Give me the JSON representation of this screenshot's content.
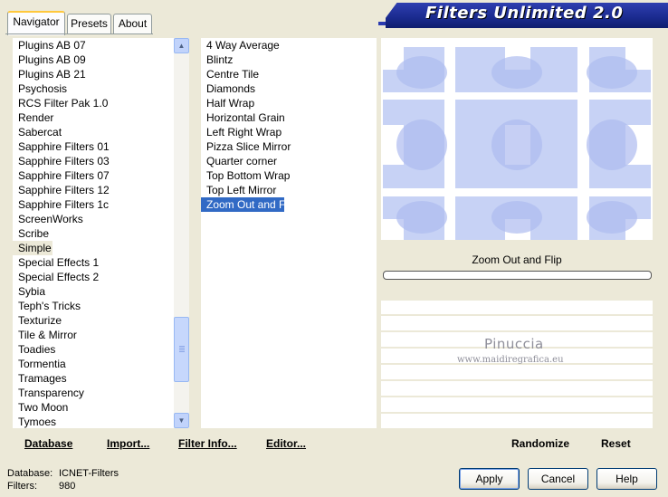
{
  "tabs": [
    {
      "label": "Navigator",
      "active": true
    },
    {
      "label": "Presets",
      "active": false
    },
    {
      "label": "About",
      "active": false
    }
  ],
  "title": "Filters Unlimited 2.0",
  "categories": [
    "Plugins AB 07",
    "Plugins AB 09",
    "Plugins AB 21",
    "Psychosis",
    "RCS Filter Pak 1.0",
    "Render",
    "Sabercat",
    "Sapphire Filters 01",
    "Sapphire Filters 03",
    "Sapphire Filters 07",
    "Sapphire Filters 12",
    "Sapphire Filters 1c",
    "ScreenWorks",
    "Scribe",
    "Simple",
    "Special Effects 1",
    "Special Effects 2",
    "Sybia",
    "Teph's Tricks",
    "Texturize",
    "Tile & Mirror",
    "Toadies",
    "Tormentia",
    "Tramages",
    "Transparency",
    "Two Moon",
    "Tymoes"
  ],
  "selected_category": "Simple",
  "filters": [
    "4 Way Average",
    "Blintz",
    "Centre Tile",
    "Diamonds",
    "Half Wrap",
    "Horizontal Grain",
    "Left Right Wrap",
    "Pizza Slice Mirror",
    "Quarter corner",
    "Top Bottom Wrap",
    "Top Left Mirror",
    "Zoom Out and Flip"
  ],
  "selected_filter": "Zoom Out and Flip",
  "preview_name": "Zoom Out and Flip",
  "progress": 0,
  "watermark": {
    "line1": "Pinuccia",
    "line2": "www.maidiregrafica.eu"
  },
  "bottom_links": {
    "database": "Database",
    "import": "Import...",
    "filter_info": "Filter Info...",
    "editor": "Editor...",
    "randomize": "Randomize",
    "reset": "Reset"
  },
  "status": {
    "database_label": "Database:",
    "database_value": "ICNET-Filters",
    "filters_label": "Filters:",
    "filters_value": "980"
  },
  "buttons": {
    "apply": "Apply",
    "cancel": "Cancel",
    "help": "Help"
  },
  "colors": {
    "selection": "#316ac5",
    "title_bg": "#1a2a8e",
    "preview_tile": "#c5d0f5"
  }
}
